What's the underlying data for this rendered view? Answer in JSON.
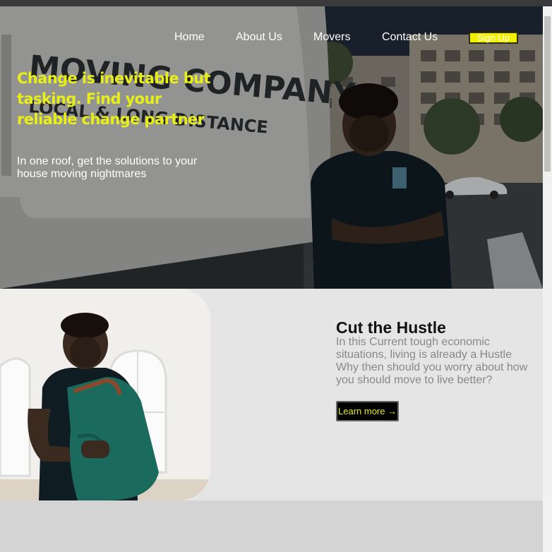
{
  "nav": {
    "links": [
      "Home",
      "About Us",
      "Movers",
      "Contact Us"
    ],
    "signup_label": "Sign Up"
  },
  "hero": {
    "headline": "Change is inevitable but tasking. Find your reliable change partner",
    "subtext": "In one roof, get the solutions to your house moving nightmares",
    "van_text_line1": "MOVING COMPANY",
    "van_text_line2": "LOCAL & LONG DISTANCE"
  },
  "feature": {
    "title": "Cut the Hustle",
    "body": "In this Current tough economic situations, living is already a Hustle Why then should you worry about how you should move to live better?",
    "cta_label": "Learn more →"
  },
  "colors": {
    "accent_yellow": "#e8ee17",
    "signup_yellow": "#f2f200",
    "feature_bg": "#e5e5e5",
    "lower_bg": "#d4d4d4"
  }
}
